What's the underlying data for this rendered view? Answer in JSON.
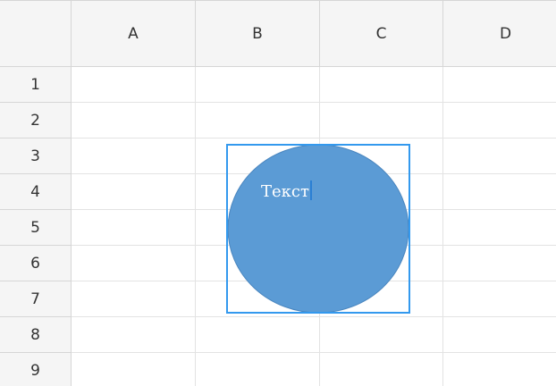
{
  "columns": [
    "A",
    "B",
    "C",
    "D"
  ],
  "rows": [
    "1",
    "2",
    "3",
    "4",
    "5",
    "6",
    "7",
    "8",
    "9"
  ],
  "shape": {
    "type": "ellipse",
    "text": "Текст",
    "fill_color": "#5b9bd5",
    "selection_color": "#3399ee",
    "text_color": "#ffffff"
  }
}
